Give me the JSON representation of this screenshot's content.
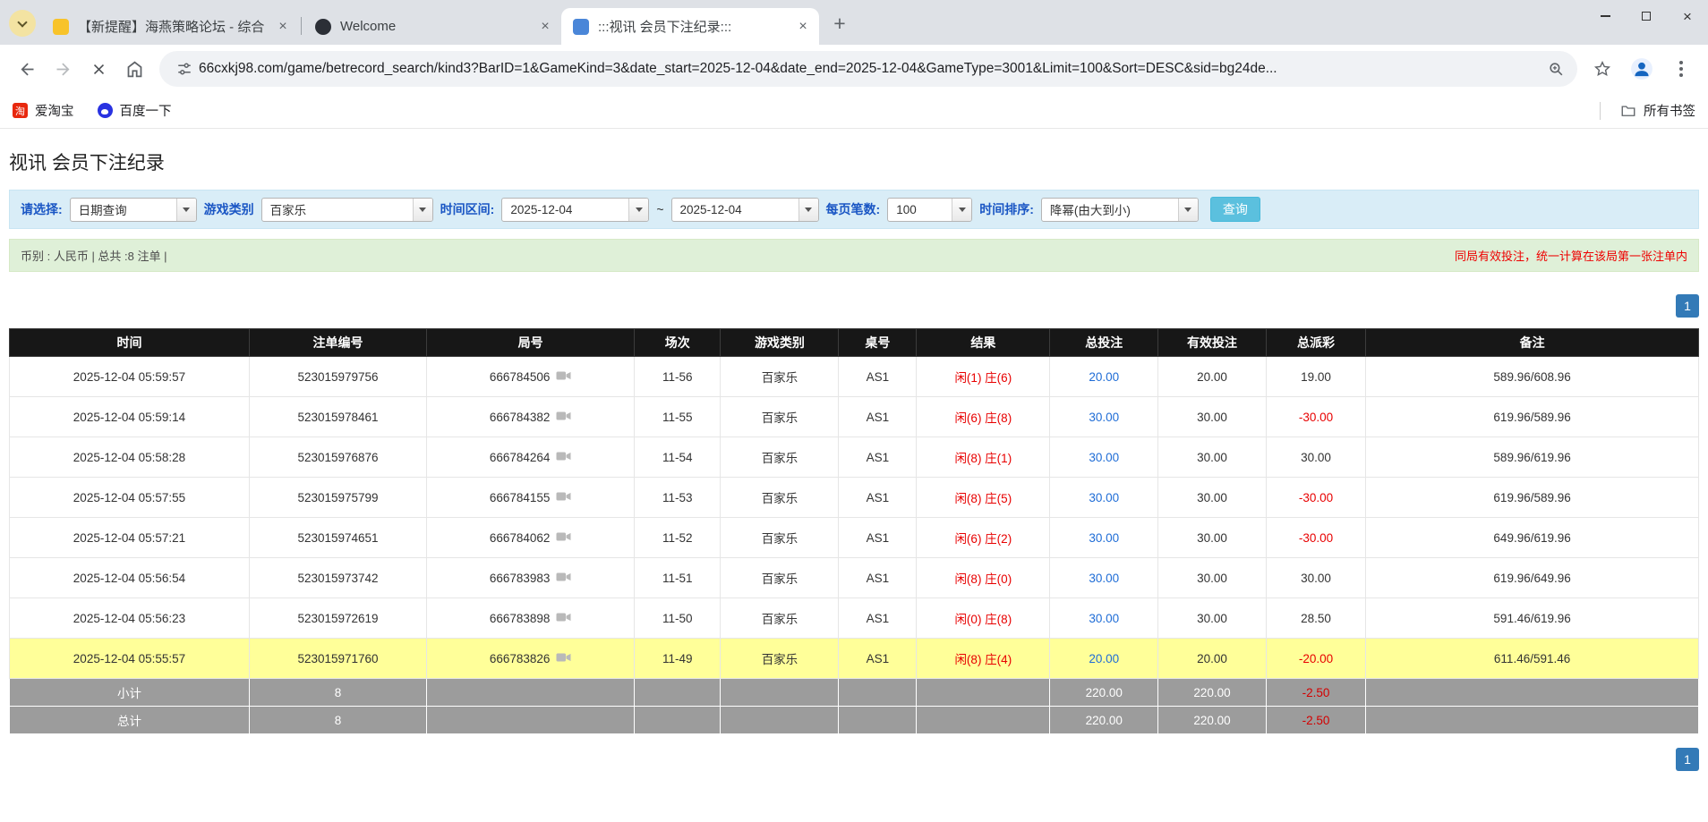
{
  "browser": {
    "tabs": [
      {
        "title": "【新提醒】海燕策略论坛 - 综合",
        "active": false
      },
      {
        "title": "Welcome",
        "active": false
      },
      {
        "title": ":::视讯 会员下注纪录:::",
        "active": true
      }
    ],
    "url": "66cxkj98.com/game/betrecord_search/kind3?BarID=1&GameKind=3&date_start=2025-12-04&date_end=2025-12-04&GameType=3001&Limit=100&Sort=DESC&sid=bg24de...",
    "bookmarks": [
      {
        "label": "爱淘宝",
        "icon": "taobao-icon"
      },
      {
        "label": "百度一下",
        "icon": "baidu-icon"
      }
    ],
    "all_bookmarks": "所有书签"
  },
  "page": {
    "title": "视讯 会员下注纪录",
    "filters": {
      "select_label": "请选择:",
      "select_value": "日期查询",
      "game_type_label": "游戏类别",
      "game_type_value": "百家乐",
      "date_range_label": "时间区间:",
      "date_start": "2025-12-04",
      "date_separator": "~",
      "date_end": "2025-12-04",
      "page_size_label": "每页笔数:",
      "page_size_value": "100",
      "sort_label": "时间排序:",
      "sort_value": "降幂(由大到小)",
      "search_button": "查询"
    },
    "info_bar": {
      "left": "币别 : 人民币 | 总共 :8 注单 |",
      "right": "同局有效投注，统一计算在该局第一张注单内"
    },
    "pagination": {
      "current": "1"
    },
    "table": {
      "headers": [
        "时间",
        "注单编号",
        "局号",
        "场次",
        "游戏类别",
        "桌号",
        "结果",
        "总投注",
        "有效投注",
        "总派彩",
        "备注"
      ],
      "rows": [
        {
          "time": "2025-12-04 05:59:57",
          "bet_id": "523015979756",
          "round": "666784506",
          "session": "11-56",
          "game": "百家乐",
          "table_no": "AS1",
          "result": "闲(1) 庄(6)",
          "total_bet": "20.00",
          "valid_bet": "20.00",
          "payout": "19.00",
          "note": "589.96/608.96",
          "highlighted": false
        },
        {
          "time": "2025-12-04 05:59:14",
          "bet_id": "523015978461",
          "round": "666784382",
          "session": "11-55",
          "game": "百家乐",
          "table_no": "AS1",
          "result": "闲(6) 庄(8)",
          "total_bet": "30.00",
          "valid_bet": "30.00",
          "payout": "-30.00",
          "note": "619.96/589.96",
          "highlighted": false
        },
        {
          "time": "2025-12-04 05:58:28",
          "bet_id": "523015976876",
          "round": "666784264",
          "session": "11-54",
          "game": "百家乐",
          "table_no": "AS1",
          "result": "闲(8) 庄(1)",
          "total_bet": "30.00",
          "valid_bet": "30.00",
          "payout": "30.00",
          "note": "589.96/619.96",
          "highlighted": false
        },
        {
          "time": "2025-12-04 05:57:55",
          "bet_id": "523015975799",
          "round": "666784155",
          "session": "11-53",
          "game": "百家乐",
          "table_no": "AS1",
          "result": "闲(8) 庄(5)",
          "total_bet": "30.00",
          "valid_bet": "30.00",
          "payout": "-30.00",
          "note": "619.96/589.96",
          "highlighted": false
        },
        {
          "time": "2025-12-04 05:57:21",
          "bet_id": "523015974651",
          "round": "666784062",
          "session": "11-52",
          "game": "百家乐",
          "table_no": "AS1",
          "result": "闲(6) 庄(2)",
          "total_bet": "30.00",
          "valid_bet": "30.00",
          "payout": "-30.00",
          "note": "649.96/619.96",
          "highlighted": false
        },
        {
          "time": "2025-12-04 05:56:54",
          "bet_id": "523015973742",
          "round": "666783983",
          "session": "11-51",
          "game": "百家乐",
          "table_no": "AS1",
          "result": "闲(8) 庄(0)",
          "total_bet": "30.00",
          "valid_bet": "30.00",
          "payout": "30.00",
          "note": "619.96/649.96",
          "highlighted": false
        },
        {
          "time": "2025-12-04 05:56:23",
          "bet_id": "523015972619",
          "round": "666783898",
          "session": "11-50",
          "game": "百家乐",
          "table_no": "AS1",
          "result": "闲(0) 庄(8)",
          "total_bet": "30.00",
          "valid_bet": "30.00",
          "payout": "28.50",
          "note": "591.46/619.96",
          "highlighted": false
        },
        {
          "time": "2025-12-04 05:55:57",
          "bet_id": "523015971760",
          "round": "666783826",
          "session": "11-49",
          "game": "百家乐",
          "table_no": "AS1",
          "result": "闲(8) 庄(4)",
          "total_bet": "20.00",
          "valid_bet": "20.00",
          "payout": "-20.00",
          "note": "611.46/591.46",
          "highlighted": true
        }
      ],
      "subtotal": {
        "label": "小计",
        "count": "8",
        "total_bet": "220.00",
        "valid_bet": "220.00",
        "payout": "-2.50"
      },
      "total": {
        "label": "总计",
        "count": "8",
        "total_bet": "220.00",
        "valid_bet": "220.00",
        "payout": "-2.50"
      }
    },
    "colors": {
      "accent_blue": "#337ab7",
      "value_blue": "#1e6cd6",
      "negative_red": "#e80000",
      "result_red": "#e80000",
      "highlight_yellow": "#ffff99",
      "filter_bar_bg": "#d9edf7",
      "info_bar_bg": "#dff0d8",
      "table_header_bg": "#171717",
      "summary_bg": "#9c9c9c",
      "search_button_bg": "#5bc0de"
    }
  }
}
